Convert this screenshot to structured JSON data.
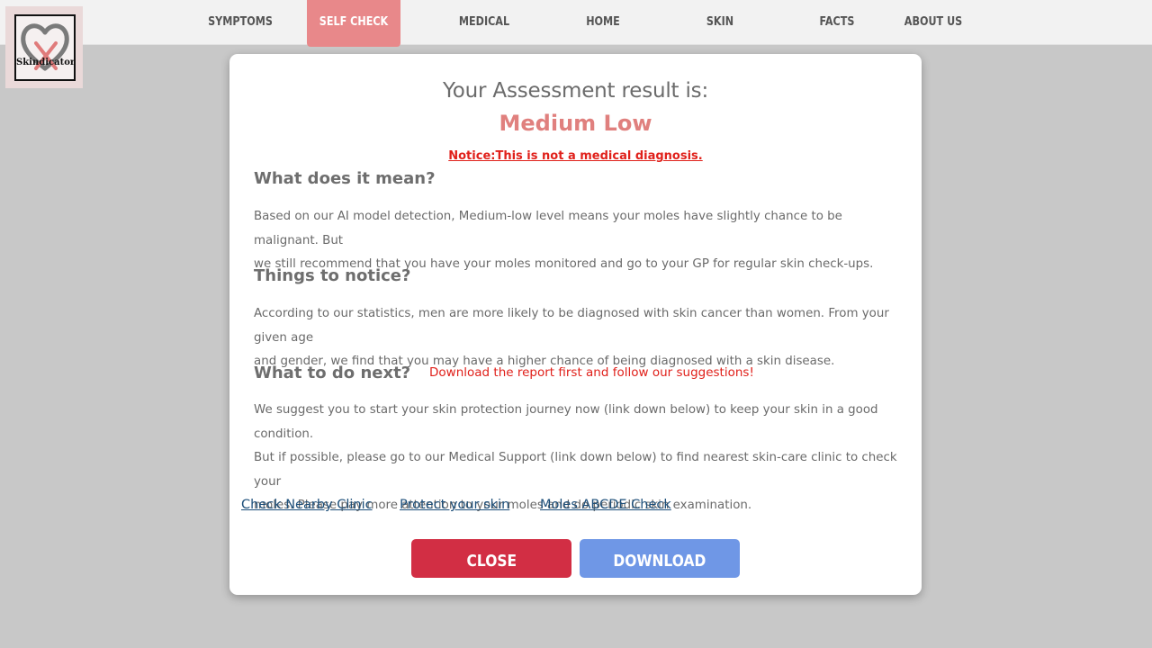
{
  "brand": {
    "logo_text": "Skindicator"
  },
  "nav": {
    "items": [
      {
        "label": "SYMPTOMS"
      },
      {
        "label": "SELF CHECK"
      },
      {
        "label": "MEDICAL SUPPORT"
      },
      {
        "label": "HOME"
      },
      {
        "label": "SKIN PROTECTION"
      },
      {
        "label": "FACTS"
      },
      {
        "label": "ABOUT US"
      }
    ],
    "active": "SELF CHECK"
  },
  "modal": {
    "title": "Your Assessment result is:",
    "result": "Medium Low",
    "notice": "Notice:This is not a medical diagnosis.",
    "sections": [
      {
        "heading": "What does it mean?",
        "body_lines": [
          "Based on our AI model detection, Medium-low level means your moles have slightly chance to be malignant. But",
          "we still recommend that you have your moles monitored and go to your GP for regular skin check-ups."
        ]
      },
      {
        "heading": "Things to notice?",
        "body_lines": [
          "According to our statistics, men are more likely to be diagnosed with skin cancer than women. From your given age",
          "and gender, we find that you may have a higher chance of being diagnosed with a skin disease."
        ]
      },
      {
        "heading": "What to do next?",
        "note": "Download the report first and follow our suggestions!",
        "body_lines": [
          "We suggest you to start your skin protection journey now (link down below) to keep your skin in a good condition.",
          "But if possible, please go to our Medical Support (link down below) to find nearest skin-care clinic to check your",
          "moles. Please pay more attention to your moles and do periodic skin examination."
        ]
      }
    ],
    "links": [
      {
        "label": "Check Nearby Clinic"
      },
      {
        "label": "Protect your skin"
      },
      {
        "label": "Moles ABCDE Check"
      }
    ],
    "buttons": {
      "close": "CLOSE",
      "download": "DOWNLOAD"
    }
  },
  "colors": {
    "nav_active": "#e8888a",
    "result": "#e0807e",
    "notice": "#e0201a",
    "close_button": "#d22e44",
    "download_button": "#6f97e6",
    "link": "#1d4f7a"
  }
}
